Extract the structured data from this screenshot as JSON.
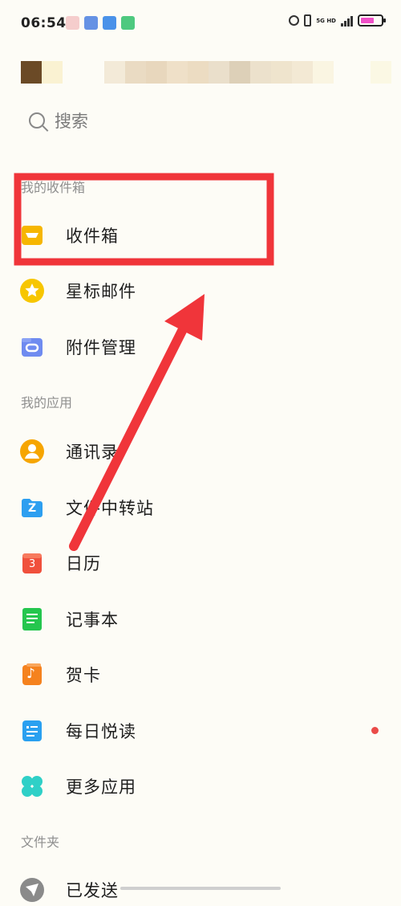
{
  "status_bar": {
    "time": "06:54",
    "network": "5G HD",
    "battery_level": 0.65
  },
  "search": {
    "placeholder": "搜索"
  },
  "sections": {
    "my_mailboxes": "我的收件箱",
    "my_apps": "我的应用",
    "folders": "文件夹"
  },
  "mailboxes": [
    {
      "label": "收件箱",
      "icon": "inbox-tray-icon",
      "color": "#f6b600"
    },
    {
      "label": "星标邮件",
      "icon": "star-icon",
      "color": "#f7c600"
    },
    {
      "label": "附件管理",
      "icon": "paperclip-icon",
      "color": "#6f8bf0"
    }
  ],
  "apps": [
    {
      "label": "通讯录",
      "icon": "contacts-icon",
      "color": "#f6a500"
    },
    {
      "label": "文件中转站",
      "icon": "folder-z-icon",
      "color": "#2d9ff0",
      "glyph": "Z"
    },
    {
      "label": "日历",
      "icon": "calendar-icon",
      "color": "#f0503c",
      "glyph": "3"
    },
    {
      "label": "记事本",
      "icon": "notepad-icon",
      "color": "#24c64e"
    },
    {
      "label": "贺卡",
      "icon": "music-note-card-icon",
      "color": "#f5821e",
      "glyph": "♪"
    },
    {
      "label": "每日悦读",
      "icon": "reading-icon",
      "color": "#2aa0f0",
      "badge": true
    },
    {
      "label": "更多应用",
      "icon": "more-apps-icon",
      "color": "#2fd0c7"
    }
  ],
  "folders": [
    {
      "label": "已发送",
      "icon": "sent-icon",
      "color": "#8a8a8a"
    }
  ],
  "annotation": {
    "highlight_color": "#f0353a",
    "arrow_color": "#f0353a"
  }
}
